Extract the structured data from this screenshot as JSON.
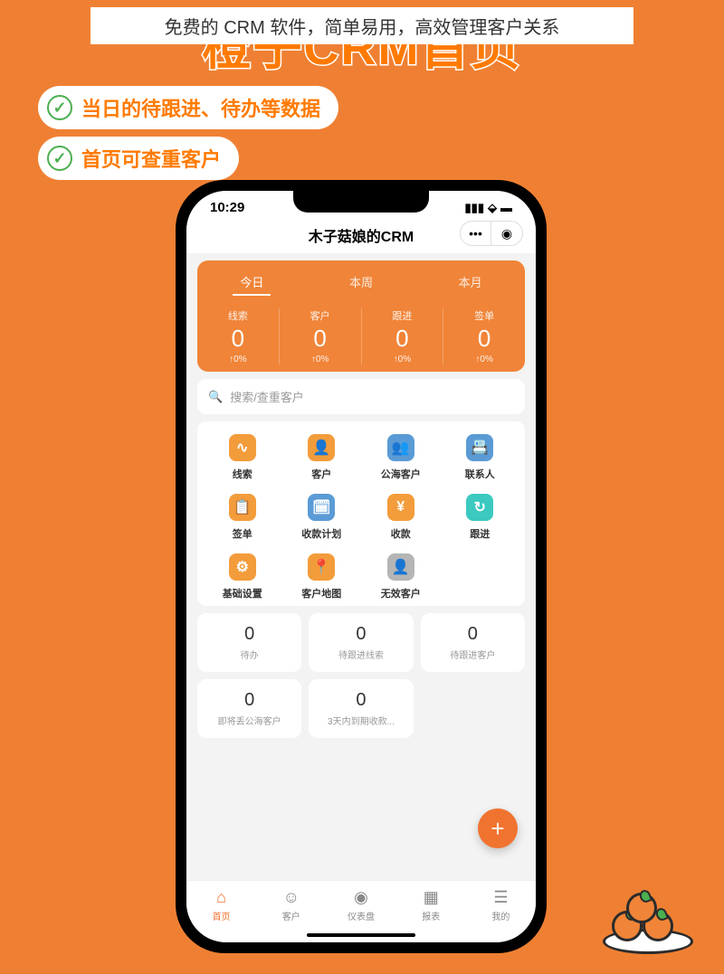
{
  "banner": "免费的 CRM 软件，简单易用，高效管理客户关系",
  "hero": "橙子CRM首页",
  "features": [
    "当日的待跟进、待办等数据",
    "首页可查重客户"
  ],
  "status": {
    "time": "10:29"
  },
  "app": {
    "title": "木子菇娘的CRM",
    "search_placeholder": "搜索/查重客户"
  },
  "period_tabs": [
    "今日",
    "本周",
    "本月"
  ],
  "stats": [
    {
      "label": "线索",
      "value": "0",
      "delta": "↑0%"
    },
    {
      "label": "客户",
      "value": "0",
      "delta": "↑0%"
    },
    {
      "label": "跟进",
      "value": "0",
      "delta": "↑0%"
    },
    {
      "label": "签单",
      "value": "0",
      "delta": "↑0%"
    }
  ],
  "grid": [
    {
      "label": "线索",
      "color": "#f39c3b",
      "glyph": "∿"
    },
    {
      "label": "客户",
      "color": "#f39c3b",
      "glyph": "👤"
    },
    {
      "label": "公海客户",
      "color": "#5b9bd5",
      "glyph": "👥"
    },
    {
      "label": "联系人",
      "color": "#5b9bd5",
      "glyph": "📇"
    },
    {
      "label": "签单",
      "color": "#f39c3b",
      "glyph": "📋"
    },
    {
      "label": "收款计划",
      "color": "#5b9bd5",
      "glyph": "🗓"
    },
    {
      "label": "收款",
      "color": "#f39c3b",
      "glyph": "¥"
    },
    {
      "label": "跟进",
      "color": "#3bc9c0",
      "glyph": "↻"
    },
    {
      "label": "基础设置",
      "color": "#f39c3b",
      "glyph": "⚙"
    },
    {
      "label": "客户地图",
      "color": "#f39c3b",
      "glyph": "📍"
    },
    {
      "label": "无效客户",
      "color": "#b5b5b5",
      "glyph": "👤"
    }
  ],
  "todos": [
    {
      "value": "0",
      "label": "待办"
    },
    {
      "value": "0",
      "label": "待跟进线索"
    },
    {
      "value": "0",
      "label": "待跟进客户"
    },
    {
      "value": "0",
      "label": "即将丢公海客户"
    },
    {
      "value": "0",
      "label": "3天内到期收款..."
    }
  ],
  "nav": [
    {
      "label": "首页",
      "glyph": "⌂"
    },
    {
      "label": "客户",
      "glyph": "☺"
    },
    {
      "label": "仪表盘",
      "glyph": "◉"
    },
    {
      "label": "报表",
      "glyph": "▦"
    },
    {
      "label": "我的",
      "glyph": "☰"
    }
  ]
}
